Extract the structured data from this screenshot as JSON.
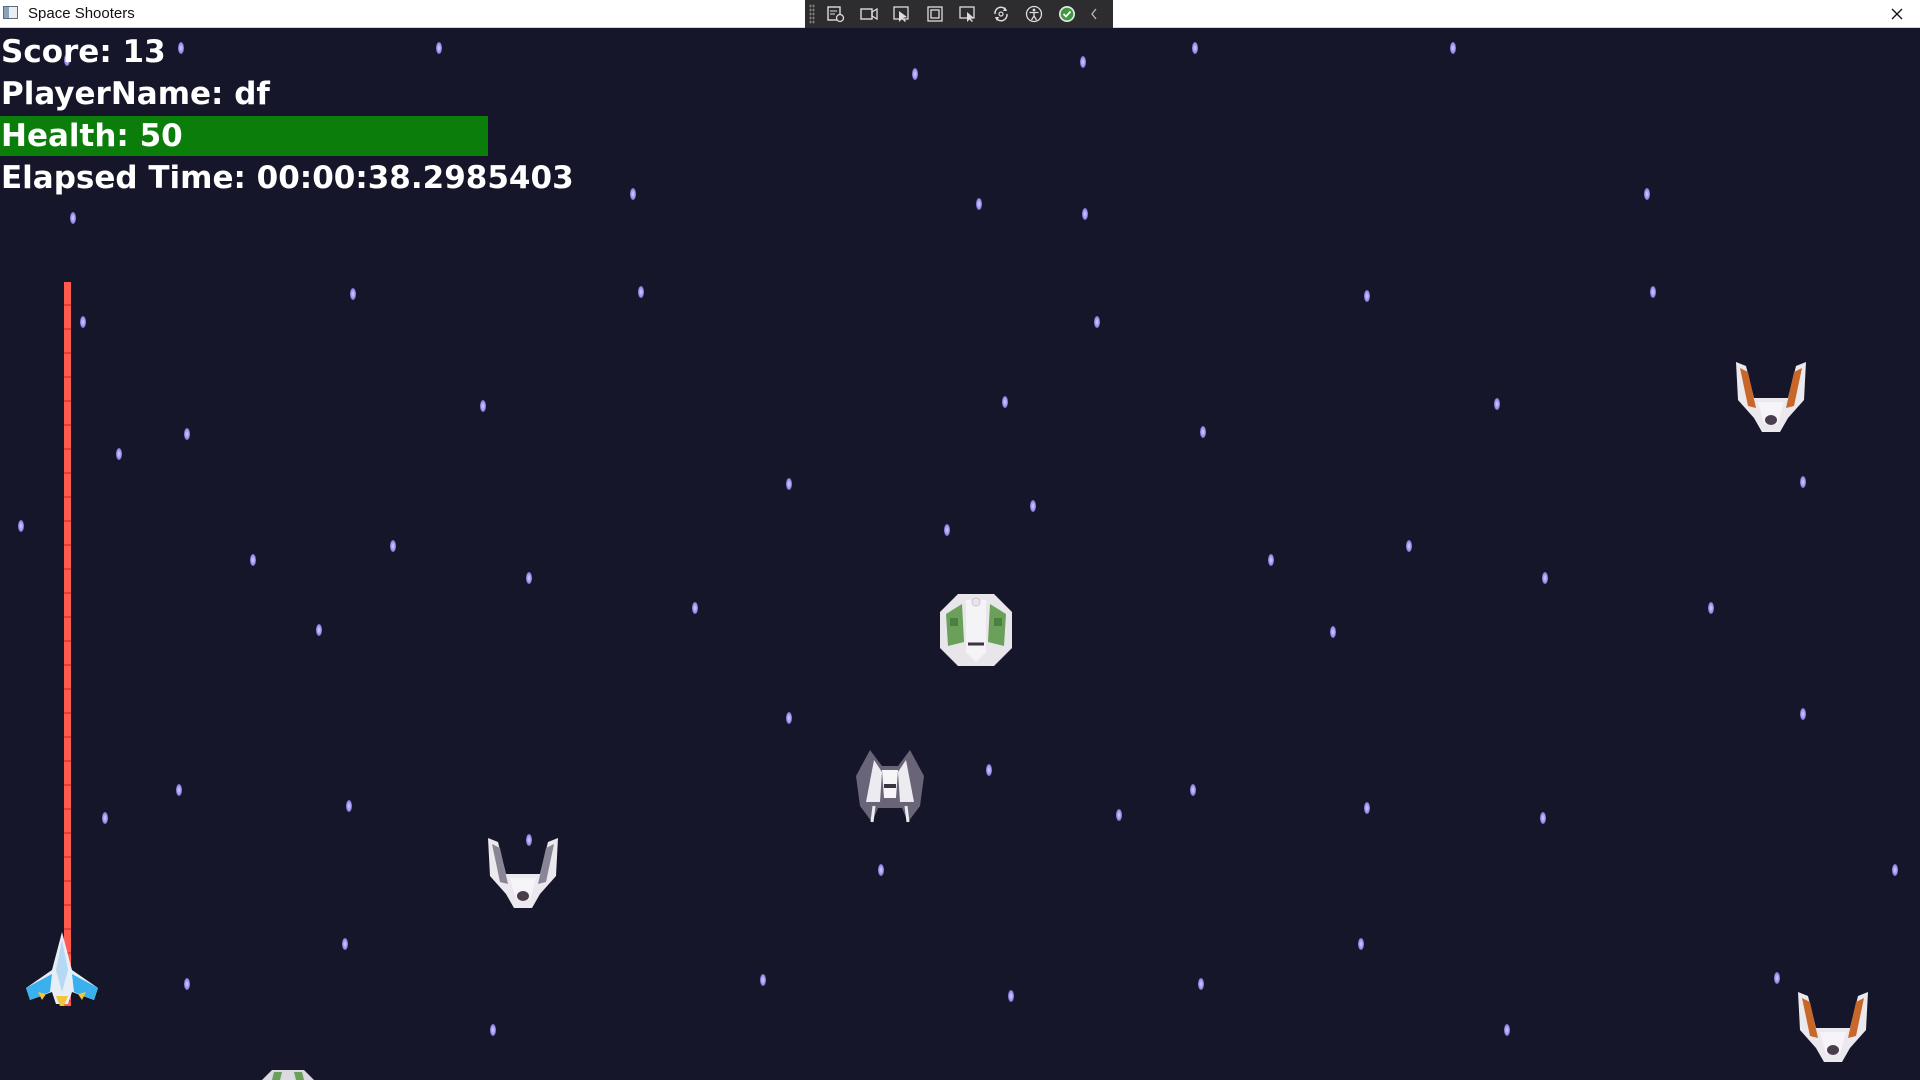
{
  "window": {
    "title": "Space Shooters",
    "close_icon": "close-icon"
  },
  "debug_toolbar": {
    "tools": [
      "live-visual-tree-icon",
      "record-icon",
      "select-element-icon",
      "display-layout-adorners-icon",
      "track-focus-icon",
      "hot-reload-icon",
      "accessibility-icon",
      "binding-check-icon",
      "collapse-chevron-icon"
    ]
  },
  "hud": {
    "score": "Score: 13",
    "player_name": "PlayerName: df",
    "health": "Health: 50",
    "health_value": 50,
    "elapsed_time": "Elapsed Time: 00:00:38.2985403"
  },
  "colors": {
    "background": "#16162a",
    "health_bar": "#0a7d0a",
    "laser": "#ff5a4e",
    "star": "#a99bf2"
  },
  "sprites": [
    "player-ship-icon",
    "enemy-ship-orange-icon",
    "enemy-ship-green-icon",
    "enemy-ship-gray-icon",
    "enemy-ship-white-icon"
  ]
}
